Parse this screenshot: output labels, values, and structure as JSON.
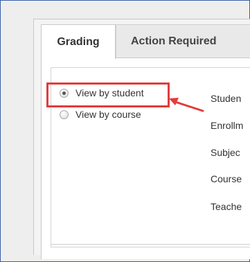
{
  "tabs": [
    {
      "label": "Grading",
      "active": true
    },
    {
      "label": "Action Required",
      "active": false
    }
  ],
  "view_options": [
    {
      "label": "View by student",
      "selected": true
    },
    {
      "label": "View by course",
      "selected": false
    }
  ],
  "fields": [
    "Studen",
    "Enrollm",
    "Subjec",
    "Course",
    "Teache"
  ],
  "annotation": {
    "color": "#e23c3c"
  }
}
